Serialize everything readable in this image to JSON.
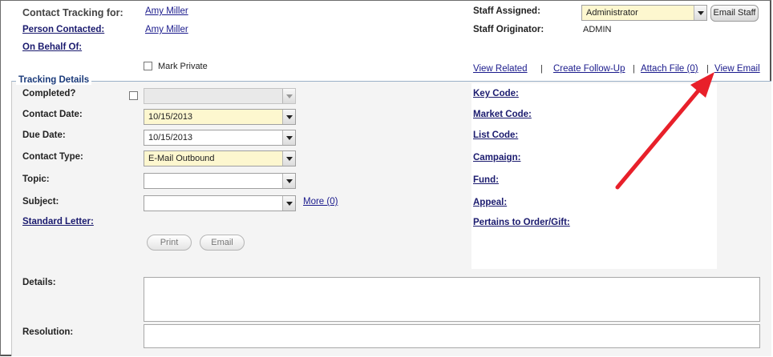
{
  "header": {
    "contact_tracking_label": "Contact Tracking for:",
    "contact_tracking_value": "Amy Miller",
    "person_contacted_label": "Person Contacted:",
    "person_contacted_value": "Amy Miller",
    "on_behalf_of_label": "On Behalf Of:",
    "mark_private_label": "Mark Private",
    "staff_assigned_label": "Staff Assigned:",
    "staff_assigned_value": "Administrator",
    "email_staff_button": "Email Staff",
    "staff_originator_label": "Staff Originator:",
    "staff_originator_value": "ADMIN"
  },
  "actions": {
    "view_related": "View Related",
    "create_follow_up": "Create Follow-Up",
    "attach_file": "Attach File (0)",
    "view_email": "View Email",
    "separator": "|"
  },
  "tracking": {
    "section_title": "Tracking Details",
    "completed_label": "Completed?",
    "contact_date_label": "Contact Date:",
    "contact_date_value": "10/15/2013",
    "due_date_label": "Due Date:",
    "due_date_value": "10/15/2013",
    "contact_type_label": "Contact Type:",
    "contact_type_value": "E-Mail Outbound",
    "topic_label": "Topic:",
    "subject_label": "Subject:",
    "more_link": "More (0)",
    "standard_letter_label": "Standard Letter:",
    "print_button": "Print",
    "email_button": "Email",
    "details_label": "Details:",
    "resolution_label": "Resolution:"
  },
  "codes": {
    "key_code": "Key Code:",
    "market_code": "Market Code:",
    "list_code": "List Code:",
    "campaign": "Campaign:",
    "fund": "Fund:",
    "appeal": "Appeal:",
    "pertains_to": "Pertains to Order/Gift:"
  },
  "colors": {
    "link": "#1a1a8c",
    "required_field": "#fdf7cf",
    "annotation_arrow": "#e8202a"
  }
}
